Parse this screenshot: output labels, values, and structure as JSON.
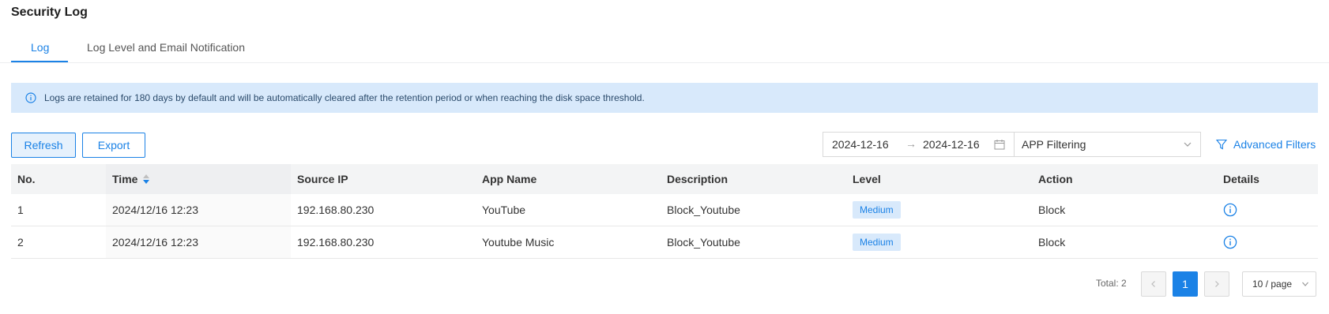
{
  "page": {
    "title": "Security Log"
  },
  "tabs": [
    {
      "label": "Log",
      "active": true
    },
    {
      "label": "Log Level and Email Notification",
      "active": false
    }
  ],
  "notice": {
    "icon": "info-icon",
    "text": "Logs are retained for 180 days by default and will be automatically cleared after the retention period or when reaching the disk space threshold."
  },
  "toolbar": {
    "refresh_label": "Refresh",
    "export_label": "Export",
    "date_start": "2024-12-16",
    "date_arrow": "→",
    "date_end": "2024-12-16",
    "filter_select": "APP Filtering",
    "advanced_filters_label": "Advanced Filters"
  },
  "table": {
    "columns": [
      "No.",
      "Time",
      "Source IP",
      "App Name",
      "Description",
      "Level",
      "Action",
      "Details"
    ],
    "rows": [
      {
        "no": "1",
        "time": "2024/12/16 12:23",
        "source_ip": "192.168.80.230",
        "app_name": "YouTube",
        "description": "Block_Youtube",
        "level": "Medium",
        "action": "Block"
      },
      {
        "no": "2",
        "time": "2024/12/16 12:23",
        "source_ip": "192.168.80.230",
        "app_name": "Youtube Music",
        "description": "Block_Youtube",
        "level": "Medium",
        "action": "Block"
      }
    ]
  },
  "pagination": {
    "total_text": "Total: 2",
    "current_page": "1",
    "page_size": "10 / page"
  },
  "colors": {
    "accent": "#1b82e6",
    "notice_bg": "#d8e9fb"
  }
}
